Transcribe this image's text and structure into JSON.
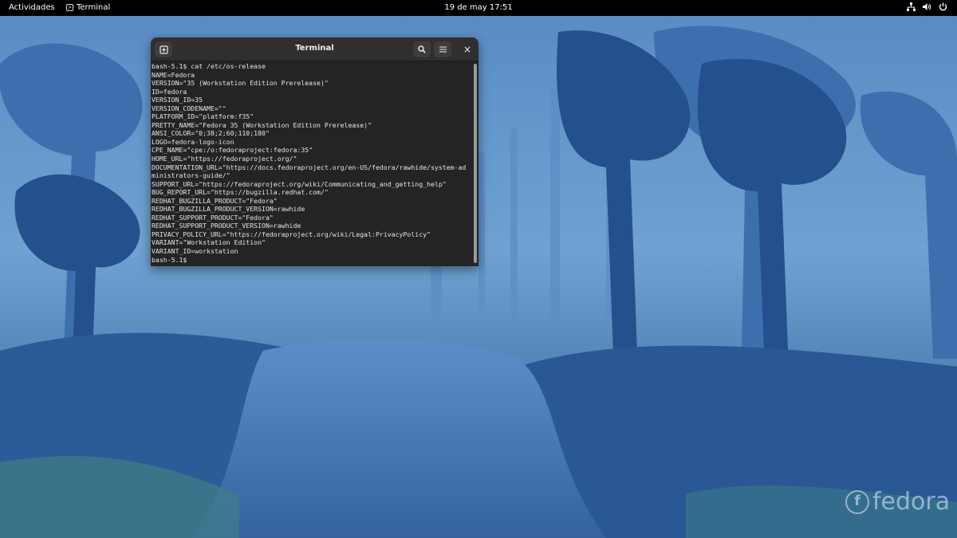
{
  "topbar": {
    "activities_label": "Actividades",
    "app_label": "Terminal",
    "app_icon": "terminal-icon",
    "clock": "19 de may  17:51",
    "tray_icons": [
      "network-icon",
      "volume-icon",
      "power-icon"
    ]
  },
  "terminal": {
    "title": "Terminal",
    "new_tab_icon": "new-tab-icon",
    "search_icon": "search-icon",
    "menu_icon": "hamburger-menu-icon",
    "close_label": "×",
    "lines": [
      "bash-5.1$ cat /etc/os-release",
      "NAME=Fedora",
      "VERSION=\"35 (Workstation Edition Prerelease)\"",
      "ID=fedora",
      "VERSION_ID=35",
      "VERSION_CODENAME=\"\"",
      "PLATFORM_ID=\"platform:f35\"",
      "PRETTY_NAME=\"Fedora 35 (Workstation Edition Prerelease)\"",
      "ANSI_COLOR=\"0;38;2;60;110;180\"",
      "LOGO=fedora-logo-icon",
      "CPE_NAME=\"cpe:/o:fedoraproject:fedora:35\"",
      "HOME_URL=\"https://fedoraproject.org/\"",
      "DOCUMENTATION_URL=\"https://docs.fedoraproject.org/en-US/fedora/rawhide/system-ad",
      "ministrators-guide/\"",
      "SUPPORT_URL=\"https://fedoraproject.org/wiki/Communicating_and_getting_help\"",
      "BUG_REPORT_URL=\"https://bugzilla.redhat.com/\"",
      "REDHAT_BUGZILLA_PRODUCT=\"Fedora\"",
      "REDHAT_BUGZILLA_PRODUCT_VERSION=rawhide",
      "REDHAT_SUPPORT_PRODUCT=\"Fedora\"",
      "REDHAT_SUPPORT_PRODUCT_VERSION=rawhide",
      "PRIVACY_POLICY_URL=\"https://fedoraproject.org/wiki/Legal:PrivacyPolicy\"",
      "VARIANT=\"Workstation Edition\"",
      "VARIANT_ID=workstation",
      "bash-5.1$"
    ]
  },
  "desktop": {
    "logo_icon": "fedora-logo-icon",
    "logo_text": "fedora"
  }
}
